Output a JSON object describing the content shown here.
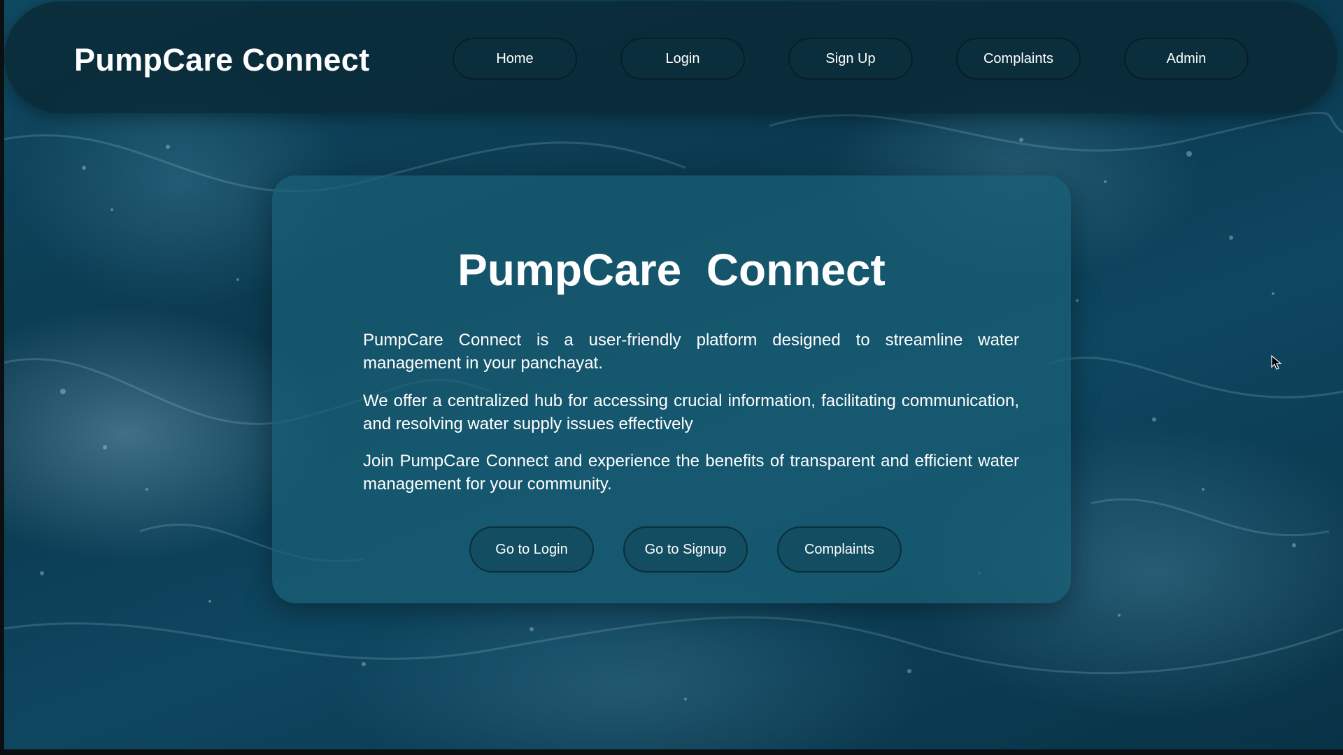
{
  "navbar": {
    "brand": "PumpCare Connect",
    "links": [
      "Home",
      "Login",
      "Sign Up",
      "Complaints",
      "Admin"
    ]
  },
  "hero": {
    "title": "PumpCare  Connect",
    "paragraphs": [
      "PumpCare Connect is a user-friendly platform designed to streamline water management in your panchayat.",
      "We offer a centralized hub for accessing crucial information, facilitating communication, and resolving water supply issues effectively",
      "Join PumpCare Connect and experience the benefits of transparent and efficient water management for your community."
    ],
    "buttons": [
      "Go to Login",
      "Go to Signup",
      "Complaints"
    ]
  },
  "icons": {
    "cursor": "mouse-pointer-icon"
  },
  "colors": {
    "navbar_bg": "#0a2834",
    "card_bg": "#195f76",
    "ocean": "#0e3c52",
    "text": "#ffffff"
  }
}
